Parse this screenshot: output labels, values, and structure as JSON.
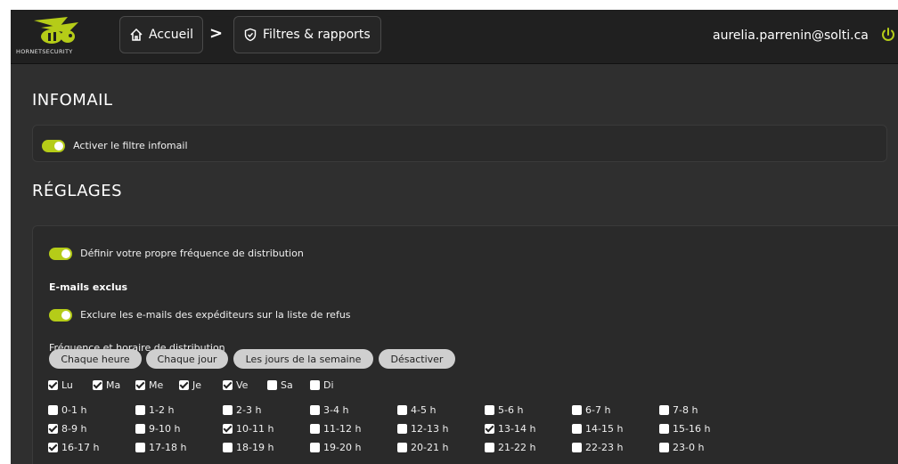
{
  "header": {
    "logo_text": "HORNETSECURITY",
    "home_label": "Accueil",
    "filters_label": "Filtres & rapports",
    "separator": ">",
    "user_email": "aurelia.parrenin@solti.ca"
  },
  "infomail": {
    "title": "INFOMAIL",
    "toggle_label": "Activer le filtre infomail",
    "toggle_on": true
  },
  "settings": {
    "title": "RÉGLAGES",
    "own_frequency_label": "Définir votre propre fréquence de distribution",
    "excluded_heading": "E-mails exclus",
    "exclude_label": "Exclure les e-mails des expéditeurs sur la liste de refus",
    "frequency_heading": "Fréquence et horaire de distribution",
    "frequency_buttons": [
      "Chaque heure",
      "Chaque jour",
      "Les jours de la semaine",
      "Désactiver"
    ],
    "days": [
      {
        "label": "Lu",
        "checked": true
      },
      {
        "label": "Ma",
        "checked": true
      },
      {
        "label": "Me",
        "checked": true
      },
      {
        "label": "Je",
        "checked": true
      },
      {
        "label": "Ve",
        "checked": true
      },
      {
        "label": "Sa",
        "checked": false
      },
      {
        "label": "Di",
        "checked": false
      }
    ],
    "hours": [
      {
        "label": "0-1 h",
        "checked": false
      },
      {
        "label": "1-2 h",
        "checked": false
      },
      {
        "label": "2-3 h",
        "checked": false
      },
      {
        "label": "3-4 h",
        "checked": false
      },
      {
        "label": "4-5 h",
        "checked": false
      },
      {
        "label": "5-6 h",
        "checked": false
      },
      {
        "label": "6-7 h",
        "checked": false
      },
      {
        "label": "7-8 h",
        "checked": false
      },
      {
        "label": "8-9 h",
        "checked": true
      },
      {
        "label": "9-10 h",
        "checked": false
      },
      {
        "label": "10-11 h",
        "checked": true
      },
      {
        "label": "11-12 h",
        "checked": false
      },
      {
        "label": "12-13 h",
        "checked": false
      },
      {
        "label": "13-14 h",
        "checked": true
      },
      {
        "label": "14-15 h",
        "checked": false
      },
      {
        "label": "15-16 h",
        "checked": false
      },
      {
        "label": "16-17 h",
        "checked": true
      },
      {
        "label": "17-18 h",
        "checked": false
      },
      {
        "label": "18-19 h",
        "checked": false
      },
      {
        "label": "19-20 h",
        "checked": false
      },
      {
        "label": "20-21 h",
        "checked": false
      },
      {
        "label": "21-22 h",
        "checked": false
      },
      {
        "label": "22-23 h",
        "checked": false
      },
      {
        "label": "23-0 h",
        "checked": false
      }
    ]
  },
  "colors": {
    "accent": "#b5cc18",
    "background": "#2f2f2f",
    "header_bg": "#202020"
  }
}
